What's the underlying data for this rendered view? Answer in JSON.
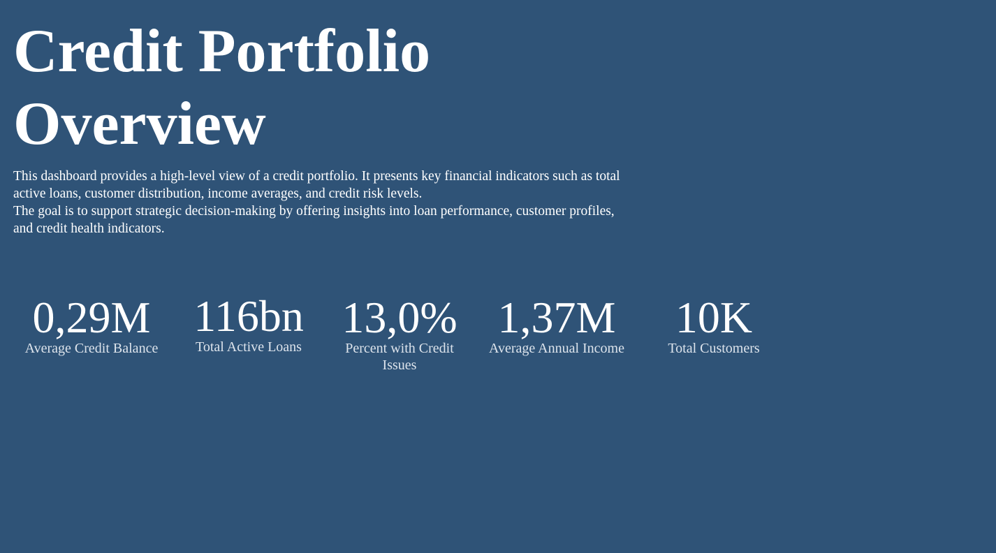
{
  "header": {
    "title_line1": "Credit Portfolio",
    "title_line2": "Overview"
  },
  "description": {
    "paragraph1": "This dashboard provides a high-level view of a credit portfolio. It presents key financial indicators such as total active loans, customer distribution, income averages, and credit risk levels.",
    "paragraph2": "The goal is to support strategic decision-making by offering insights into loan performance, customer profiles, and credit health indicators."
  },
  "kpis": [
    {
      "value": "0,29M",
      "label": "Average Credit Balance"
    },
    {
      "value": "116bn",
      "label": "Total Active Loans"
    },
    {
      "value": "13,0%",
      "label": "Percent with Credit Issues"
    },
    {
      "value": "1,37M",
      "label": "Average Annual Income"
    },
    {
      "value": "10K",
      "label": "Total Customers"
    }
  ],
  "colors": {
    "background": "#2f5377",
    "text": "#ffffff",
    "label": "#dde4ec"
  }
}
